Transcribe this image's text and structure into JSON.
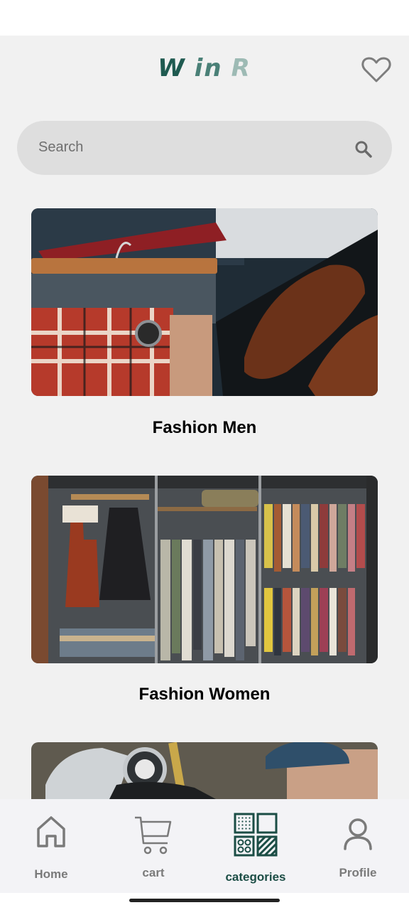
{
  "app": {
    "logo_letters": [
      "W",
      "in",
      "R"
    ]
  },
  "search": {
    "placeholder": "Search"
  },
  "categories": [
    {
      "label": "Fashion Men"
    },
    {
      "label": "Fashion Women"
    },
    {
      "label": ""
    }
  ],
  "bottom_nav": {
    "items": [
      {
        "label": "Home",
        "icon": "home-icon",
        "active": false
      },
      {
        "label": "cart",
        "icon": "cart-icon",
        "active": false
      },
      {
        "label": "categories",
        "icon": "categories-grid-icon",
        "active": true
      },
      {
        "label": "Profile",
        "icon": "profile-icon",
        "active": false
      }
    ]
  },
  "colors": {
    "brand": "#1b4d45",
    "background": "#f1f1f1",
    "search_bg": "#dedede",
    "nav_inactive": "#7a7a7a"
  }
}
